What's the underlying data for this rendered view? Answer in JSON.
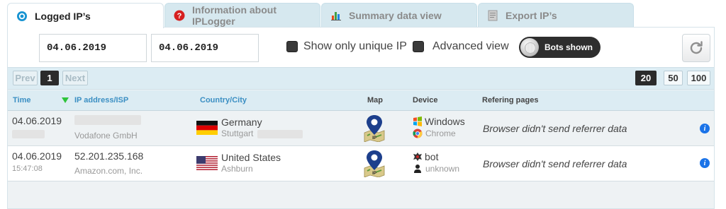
{
  "tabs": [
    {
      "label": "Logged IP’s",
      "icon": "target-icon",
      "active": true
    },
    {
      "label": "Information about IPLogger",
      "icon": "question-icon"
    },
    {
      "label": "Summary data view",
      "icon": "bar-chart-icon"
    },
    {
      "label": "Export IP’s",
      "icon": "document-icon"
    }
  ],
  "filters": {
    "date_from": "04.06.2019",
    "date_to": "04.06.2019",
    "unique_ip_label": "Show only unique IP",
    "advanced_view_label": "Advanced view",
    "bots_toggle_label": "Bots shown"
  },
  "pager": {
    "prev": "Prev",
    "current_page": "1",
    "next": "Next",
    "page_sizes": [
      "20",
      "50",
      "100"
    ],
    "active_page_size": "20"
  },
  "table": {
    "headers": {
      "time": "Time",
      "ip": "IP address/ISP",
      "country": "Country/City",
      "map": "Map",
      "device": "Device",
      "referrer": "Refering pages"
    },
    "rows": [
      {
        "date": "04.06.2019",
        "time": "",
        "ip": "",
        "isp": "Vodafone GmbH",
        "country": "Germany",
        "city": "Stuttgart",
        "os": "Windows",
        "browser": "Chrome",
        "referrer": "Browser didn't send referrer data",
        "map_label": "IP"
      },
      {
        "date": "04.06.2019",
        "time": "15:47:08",
        "ip": "52.201.235.168",
        "isp": "Amazon.com, Inc.",
        "country": "United States",
        "city": "Ashburn",
        "os": "bot",
        "browser": "unknown",
        "referrer": "Browser didn't send referrer data",
        "map_label": "IP"
      }
    ]
  },
  "colors": {
    "accent": "#3b8fc3",
    "header_bg": "#dcecf3",
    "sort_arrow": "#2ec43a",
    "info_icon": "#1a73e8"
  }
}
